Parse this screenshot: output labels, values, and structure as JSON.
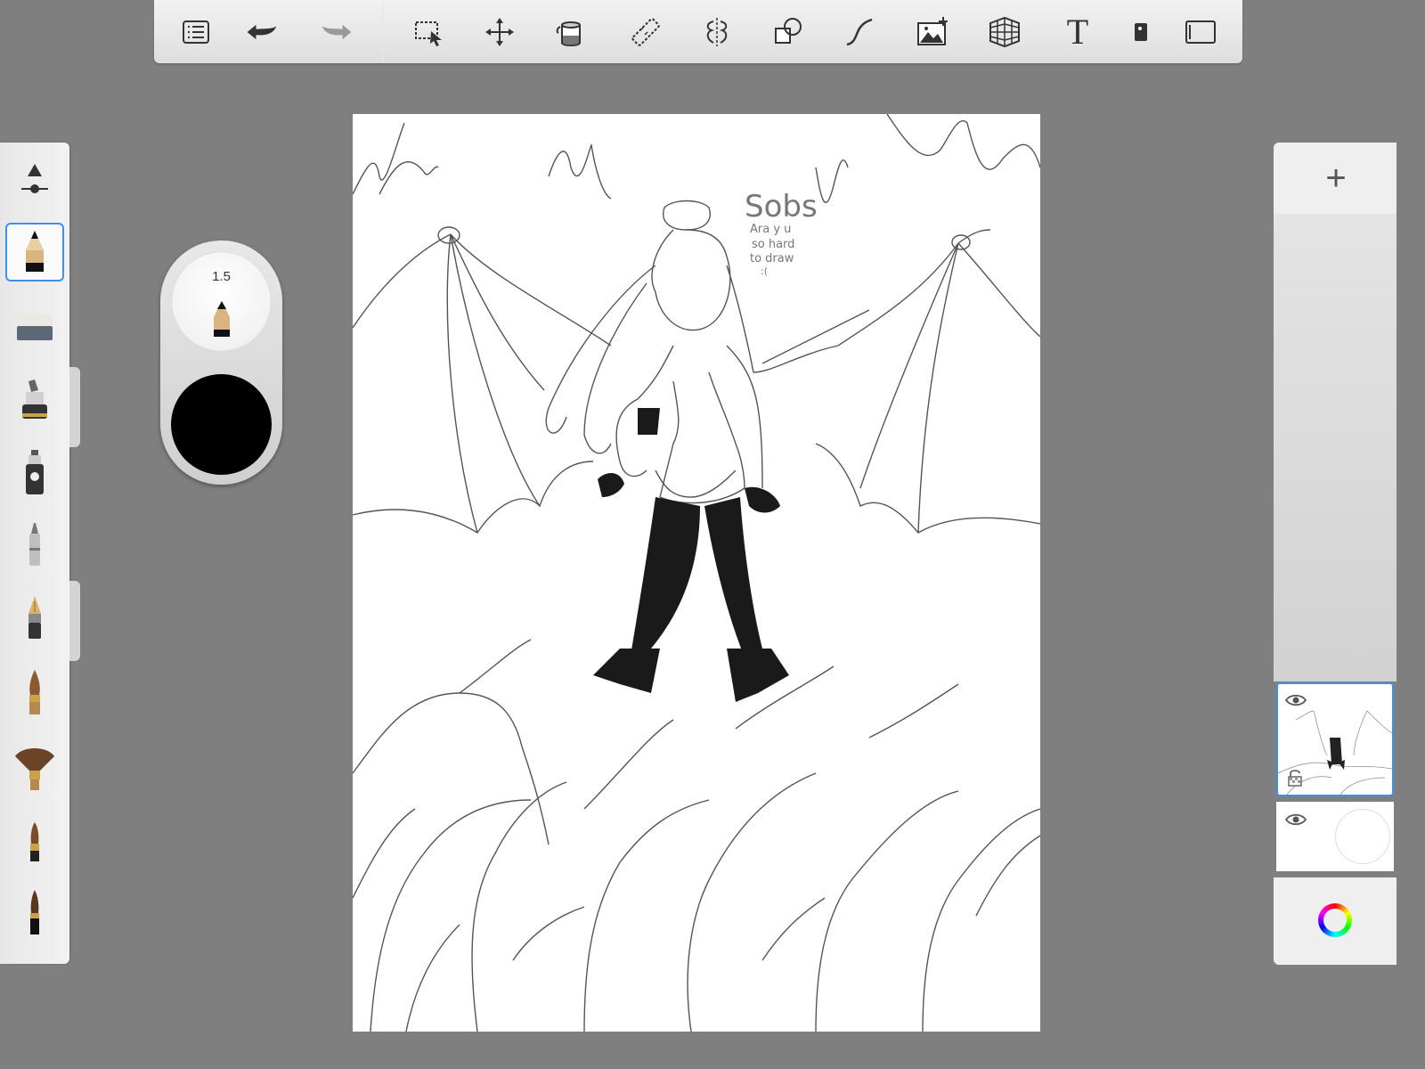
{
  "toolbar": {
    "items": [
      {
        "name": "list-icon"
      },
      {
        "name": "undo-icon"
      },
      {
        "name": "redo-icon"
      },
      {
        "name": "selection-icon"
      },
      {
        "name": "transform-icon"
      },
      {
        "name": "fill-bucket-icon"
      },
      {
        "name": "ruler-icon"
      },
      {
        "name": "symmetry-icon"
      },
      {
        "name": "shapes-icon"
      },
      {
        "name": "curve-icon"
      },
      {
        "name": "add-image-icon"
      },
      {
        "name": "perspective-grid-icon"
      },
      {
        "name": "text-icon"
      },
      {
        "name": "predictive-stroke-icon"
      },
      {
        "name": "canvas-view-icon"
      }
    ],
    "text_tool_label": "T"
  },
  "brushes": [
    {
      "name": "pencil",
      "selected": true
    },
    {
      "name": "eraser"
    },
    {
      "name": "marker"
    },
    {
      "name": "airbrush"
    },
    {
      "name": "ballpoint-pen"
    },
    {
      "name": "fountain-pen"
    },
    {
      "name": "paint-brush"
    },
    {
      "name": "fan-brush"
    },
    {
      "name": "round-brush"
    },
    {
      "name": "ink-pen"
    }
  ],
  "puck": {
    "size_value": "1.5",
    "color": "#000000"
  },
  "canvas": {
    "note_title": "Sobs",
    "note_lines": [
      "Ara y u",
      "so hard",
      "to draw",
      ":("
    ]
  },
  "layers": {
    "add_label": "+",
    "items": [
      {
        "name": "drawing-layer",
        "visible": true,
        "selected": true
      },
      {
        "name": "background-layer",
        "visible": true,
        "selected": false
      }
    ]
  },
  "colors": {
    "accent": "#3d8ff0",
    "background": "#7f7f7f"
  }
}
